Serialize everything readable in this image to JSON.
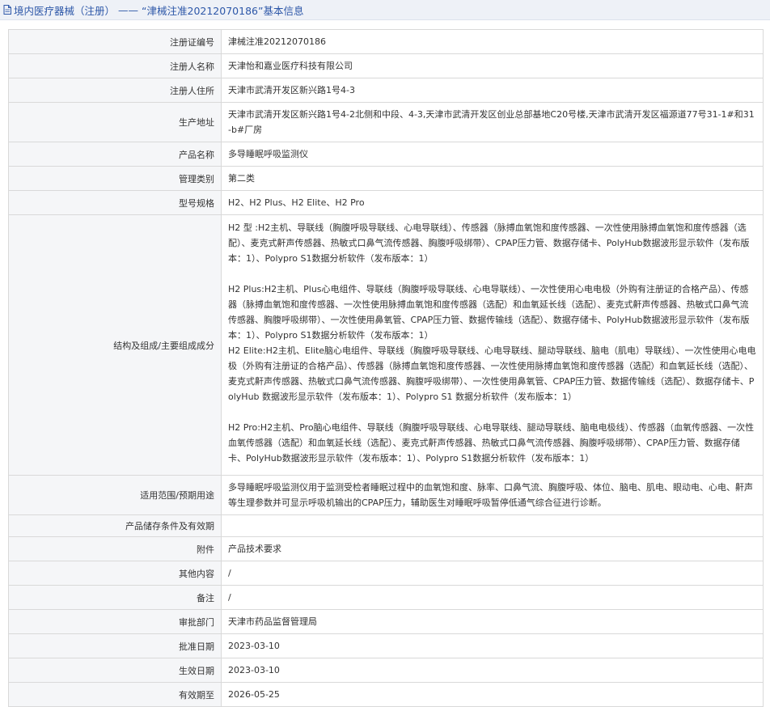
{
  "header": {
    "category": "境内医疗器械（注册）",
    "separator": "——",
    "subject": "“津械注准20212070186”基本信息"
  },
  "rows": [
    {
      "label": "注册证编号",
      "value": "津械注准20212070186"
    },
    {
      "label": "注册人名称",
      "value": "天津怡和嘉业医疗科技有限公司"
    },
    {
      "label": "注册人住所",
      "value": "天津市武清开发区新兴路1号4-3"
    },
    {
      "label": "生产地址",
      "value": "天津市武清开发区新兴路1号4-2北侧和中段、4-3,天津市武清开发区创业总部基地C20号楼,天津市武清开发区福源道77号31-1#和31-b#厂房"
    },
    {
      "label": "产品名称",
      "value": "多导睡眠呼吸监测仪"
    },
    {
      "label": "管理类别",
      "value": "第二类"
    },
    {
      "label": "型号规格",
      "value": "H2、H2 Plus、H2 Elite、H2 Pro"
    }
  ],
  "structure": {
    "label": "结构及组成/主要组成成分",
    "paragraphs": [
      "H2 型 :H2主机、导联线（胸腹呼吸导联线、心电导联线）、传感器（脉搏血氧饱和度传感器、一次性使用脉搏血氧饱和度传感器（选配）、麦克式鼾声传感器、热敏式口鼻气流传感器、胸腹呼吸绑带）、CPAP压力管、数据存储卡、PolyHub数据波形显示软件（发布版本：1）、Polypro S1数据分析软件（发布版本：1）",
      "H2 Plus:H2主机、Plus心电组件、导联线（胸腹呼吸导联线、心电导联线）、一次性使用心电电极（外购有注册证的合格产品）、传感器（脉搏血氧饱和度传感器、一次性使用脉搏血氧饱和度传感器（选配）和血氧延长线（选配）、麦克式鼾声传感器、热敏式口鼻气流传感器、胸腹呼吸绑带）、一次性使用鼻氧管、CPAP压力管、数据传输线（选配）、数据存储卡、PolyHub数据波形显示软件（发布版本：1）、Polypro S1数据分析软件（发布版本：1）",
      "H2 Elite:H2主机、Elite脑心电组件、导联线（胸腹呼吸导联线、心电导联线、腿动导联线、脑电（肌电）导联线）、一次性使用心电电极（外购有注册证的合格产品）、传感器（脉搏血氧饱和度传感器、一次性使用脉搏血氧饱和度传感器（选配）和血氧延长线（选配）、麦克式鼾声传感器、热敏式口鼻气流传感器、胸腹呼吸绑带）、一次性使用鼻氧管、CPAP压力管、数据传输线（选配）、数据存储卡、PolyHub 数据波形显示软件（发布版本：1）、Polypro S1 数据分析软件（发布版本：1）",
      "H2 Pro:H2主机、Pro脑心电组件、导联线（胸腹呼吸导联线、心电导联线、腿动导联线、脑电电极线）、传感器（血氧传感器、一次性血氧传感器（选配）和血氧延长线（选配）、麦克式鼾声传感器、热敏式口鼻气流传感器、胸腹呼吸绑带）、CPAP压力管、数据存储卡、PolyHub数据波形显示软件（发布版本：1）、Polypro S1数据分析软件（发布版本：1）"
    ]
  },
  "rows_after": [
    {
      "label": "适用范围/预期用途",
      "value": "多导睡眠呼吸监测仪用于监测受检者睡眠过程中的血氧饱和度、脉率、口鼻气流、胸腹呼吸、体位、脑电、肌电、眼动电、心电、鼾声等生理参数并可显示呼吸机输出的CPAP压力，辅助医生对睡眠呼吸暂停低通气综合征进行诊断。"
    },
    {
      "label": "产品储存条件及有效期",
      "value": ""
    },
    {
      "label": "附件",
      "value": "产品技术要求"
    },
    {
      "label": "其他内容",
      "value": "/"
    },
    {
      "label": "备注",
      "value": "/"
    },
    {
      "label": "审批部门",
      "value": "天津市药品监督管理局"
    },
    {
      "label": "批准日期",
      "value": "2023-03-10"
    },
    {
      "label": "生效日期",
      "value": "2023-03-10"
    },
    {
      "label": "有效期至",
      "value": "2026-05-25"
    }
  ]
}
